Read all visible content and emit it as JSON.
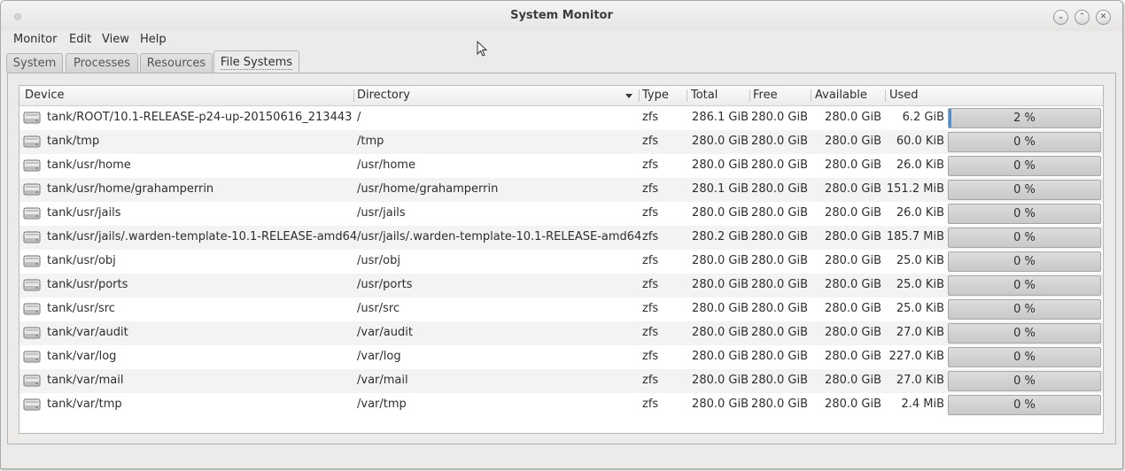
{
  "window": {
    "title": "System Monitor"
  },
  "menu": [
    "Monitor",
    "Edit",
    "View",
    "Help"
  ],
  "tabs": [
    "System",
    "Processes",
    "Resources",
    "File Systems"
  ],
  "active_tab": "File Systems",
  "columns": [
    "Device",
    "Directory",
    "Type",
    "Total",
    "Free",
    "Available",
    "Used"
  ],
  "sorted_column": "Directory",
  "rows": [
    {
      "device": "tank/ROOT/10.1-RELEASE-p24-up-20150616_213443",
      "directory": "/",
      "type": "zfs",
      "total": "286.1 GiB",
      "free": "280.0 GiB",
      "available": "280.0 GiB",
      "used": "6.2 GiB",
      "used_pct": 0.02,
      "used_pct_label": "2 %"
    },
    {
      "device": "tank/tmp",
      "directory": "/tmp",
      "type": "zfs",
      "total": "280.0 GiB",
      "free": "280.0 GiB",
      "available": "280.0 GiB",
      "used": "60.0 KiB",
      "used_pct": 0,
      "used_pct_label": "0 %"
    },
    {
      "device": "tank/usr/home",
      "directory": "/usr/home",
      "type": "zfs",
      "total": "280.0 GiB",
      "free": "280.0 GiB",
      "available": "280.0 GiB",
      "used": "26.0 KiB",
      "used_pct": 0,
      "used_pct_label": "0 %"
    },
    {
      "device": "tank/usr/home/grahamperrin",
      "directory": "/usr/home/grahamperrin",
      "type": "zfs",
      "total": "280.1 GiB",
      "free": "280.0 GiB",
      "available": "280.0 GiB",
      "used": "151.2 MiB",
      "used_pct": 0,
      "used_pct_label": "0 %"
    },
    {
      "device": "tank/usr/jails",
      "directory": "/usr/jails",
      "type": "zfs",
      "total": "280.0 GiB",
      "free": "280.0 GiB",
      "available": "280.0 GiB",
      "used": "26.0 KiB",
      "used_pct": 0,
      "used_pct_label": "0 %"
    },
    {
      "device": "tank/usr/jails/.warden-template-10.1-RELEASE-amd64",
      "directory": "/usr/jails/.warden-template-10.1-RELEASE-amd64",
      "type": "zfs",
      "total": "280.2 GiB",
      "free": "280.0 GiB",
      "available": "280.0 GiB",
      "used": "185.7 MiB",
      "used_pct": 0,
      "used_pct_label": "0 %"
    },
    {
      "device": "tank/usr/obj",
      "directory": "/usr/obj",
      "type": "zfs",
      "total": "280.0 GiB",
      "free": "280.0 GiB",
      "available": "280.0 GiB",
      "used": "25.0 KiB",
      "used_pct": 0,
      "used_pct_label": "0 %"
    },
    {
      "device": "tank/usr/ports",
      "directory": "/usr/ports",
      "type": "zfs",
      "total": "280.0 GiB",
      "free": "280.0 GiB",
      "available": "280.0 GiB",
      "used": "25.0 KiB",
      "used_pct": 0,
      "used_pct_label": "0 %"
    },
    {
      "device": "tank/usr/src",
      "directory": "/usr/src",
      "type": "zfs",
      "total": "280.0 GiB",
      "free": "280.0 GiB",
      "available": "280.0 GiB",
      "used": "25.0 KiB",
      "used_pct": 0,
      "used_pct_label": "0 %"
    },
    {
      "device": "tank/var/audit",
      "directory": "/var/audit",
      "type": "zfs",
      "total": "280.0 GiB",
      "free": "280.0 GiB",
      "available": "280.0 GiB",
      "used": "27.0 KiB",
      "used_pct": 0,
      "used_pct_label": "0 %"
    },
    {
      "device": "tank/var/log",
      "directory": "/var/log",
      "type": "zfs",
      "total": "280.0 GiB",
      "free": "280.0 GiB",
      "available": "280.0 GiB",
      "used": "227.0 KiB",
      "used_pct": 0,
      "used_pct_label": "0 %"
    },
    {
      "device": "tank/var/mail",
      "directory": "/var/mail",
      "type": "zfs",
      "total": "280.0 GiB",
      "free": "280.0 GiB",
      "available": "280.0 GiB",
      "used": "27.0 KiB",
      "used_pct": 0,
      "used_pct_label": "0 %"
    },
    {
      "device": "tank/var/tmp",
      "directory": "/var/tmp",
      "type": "zfs",
      "total": "280.0 GiB",
      "free": "280.0 GiB",
      "available": "280.0 GiB",
      "used": "2.4 MiB",
      "used_pct": 0,
      "used_pct_label": "0 %"
    }
  ],
  "icons": {
    "row": "harddisk-icon",
    "window_menu": "window-menu-icon",
    "minimize": "minimize-icon",
    "maximize": "maximize-icon",
    "close": "close-icon",
    "sort": "sort-descending-icon",
    "cursor": "mouse-pointer-icon"
  },
  "colors": {
    "usage_fill": "#4a90d9",
    "window_bg": "#ecebe9"
  }
}
